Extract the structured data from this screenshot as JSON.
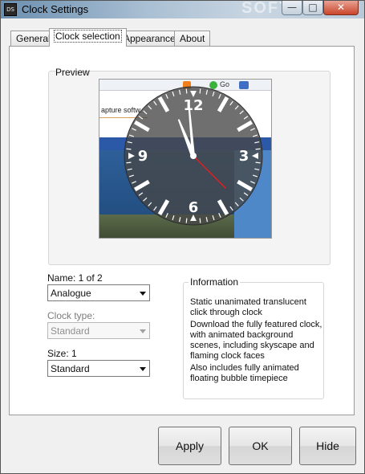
{
  "window": {
    "title": "Clock Settings",
    "app_icon_text": "DS",
    "title_watermark": "SOFTP",
    "controls": {
      "minimize": "—",
      "maximize": "□",
      "close": "✕"
    }
  },
  "tabs": [
    {
      "label": "General",
      "active": false
    },
    {
      "label": "Clock selection",
      "active": true
    },
    {
      "label": "Appearance",
      "active": false
    },
    {
      "label": "About",
      "active": false
    }
  ],
  "preview": {
    "legend": "Preview",
    "image": {
      "caption": "apture softw...",
      "toolbar_go": "Go",
      "clock_numerals": [
        "12",
        "3",
        "6",
        "9"
      ],
      "colors": {
        "face": "#555555",
        "hands": "#ffffff",
        "second_hand": "#e01f1f"
      }
    }
  },
  "name": {
    "label": "Name: 1 of 2",
    "selected": "Analogue"
  },
  "clock_type": {
    "label": "Clock type:",
    "selected": "Standard",
    "disabled": true
  },
  "size": {
    "label": "Size: 1",
    "selected": "Standard"
  },
  "information": {
    "legend": "Information",
    "lines": [
      "Static unanimated translucent click through clock",
      "Download the fully featured clock, with animated background scenes, including skyscape and flaming clock faces",
      "Also includes fully animated floating bubble timepiece"
    ]
  },
  "buttons": {
    "apply": "Apply",
    "ok": "OK",
    "hide": "Hide"
  }
}
